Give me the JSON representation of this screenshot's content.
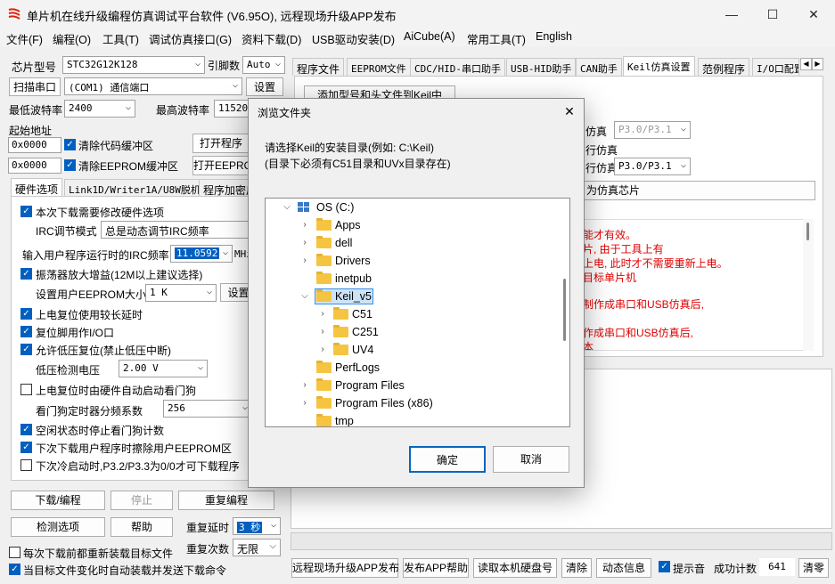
{
  "window": {
    "title": "单片机在线升级编程仿真调试平台软件 (V6.95O), 远程现场升级APP发布",
    "minimize": "—",
    "maximize": "☐",
    "close": "✕"
  },
  "menu": [
    "文件(F)",
    "编程(O)",
    "工具(T)",
    "调试仿真接口(G)",
    "资料下载(D)",
    "USB驱动安装(D)",
    "AiCube(A)",
    "常用工具(T)",
    "English"
  ],
  "left": {
    "chip_label": "芯片型号",
    "chip_value": "STC32G12K128",
    "pin_label": "引脚数",
    "pin_value": "Auto",
    "scan_button": "扫描串口",
    "port_value": "(COM1) 通信端口",
    "settings_button": "设置",
    "min_baud_label": "最低波特率",
    "min_baud_value": "2400",
    "max_baud_label": "最高波特率",
    "max_baud_value": "11520",
    "start_addr_label": "起始地址",
    "addr1": "0x0000",
    "clear_code_label": "清除代码缓冲区",
    "open_prog_button": "打开程序",
    "addr2": "0x0000",
    "clear_eeprom_label": "清除EEPROM缓冲区",
    "open_eeprom_button": "打开EEPRO",
    "tabs": [
      "硬件选项",
      "Link1D/Writer1A/U8W脱机",
      "程序加密后"
    ],
    "opt_modify_hw": "本次下载需要修改硬件选项",
    "irc_adjust_label": "IRC调节模式",
    "irc_adjust_value": "总是动态调节IRC频率",
    "irc_freq_label": "输入用户程序运行时的IRC频率",
    "irc_freq_value": "11.0592",
    "irc_unit": "MHz",
    "osc_gain": "振荡器放大增益(12M以上建议选择)",
    "eeprom_size_label": "设置用户EEPROM大小",
    "eeprom_size_value": "1   K",
    "eeprom_set_button": "设置",
    "long_reset_delay": "上电复位使用较长延时",
    "reset_pin_io": "复位脚用作I/O口",
    "lvd_reset": "允许低压复位(禁止低压中断)",
    "lvd_voltage_label": "低压检测电压",
    "lvd_voltage_value": "2.00 V",
    "wdt_auto": "上电复位时由硬件自动启动看门狗",
    "wdt_div_label": "看门狗定时器分频系数",
    "wdt_div_value": "256",
    "idle_stop_wdt": "空闲状态时停止看门狗计数",
    "erase_eeprom": "下次下载用户程序时擦除用户EEPROM区",
    "p32_p33": "下次冷启动时,P3.2/P3.3为0/0才可下载程序",
    "download_button": "下载/编程",
    "stop_button": "停止",
    "reprogram_button": "重复编程",
    "detect_button": "检测选项",
    "help_button": "帮助",
    "repeat_delay_label": "重复延时",
    "repeat_delay_value": "3 秒",
    "repeat_count_label": "重复次数",
    "repeat_count_value": "无限",
    "reload_each": "每次下载前都重新装载目标文件",
    "auto_reload": "当目标文件变化时自动装载并发送下载命令"
  },
  "right": {
    "tabs": [
      "程序文件",
      "EEPROM文件",
      "CDC/HID-串口助手",
      "USB-HID助手",
      "CAN助手",
      "Keil仿真设置",
      "范例程序",
      "I/O口配置"
    ],
    "add_to_keil": "添加型号和头文件到Keil中",
    "sim_label1": "仿真",
    "sim_value1": "P3.0/P3.1",
    "sim_label2": "行仿真",
    "sim_label3": "行仿真",
    "sim_value3": "P3.0/P3.1",
    "set_sim_chip": "为仿真芯片",
    "red_lines": [
      "能才有效。",
      "片, 由于工具上有",
      "上电, 此时才不需要重新上电。",
      "目标单片机",
      "制作成串口和USB仿真后,",
      "作成串口和USB仿真后,",
      "本"
    ]
  },
  "bottom": {
    "remote_publish": "远程现场升级APP发布",
    "publish_help": "发布APP帮助",
    "read_disk": "读取本机硬盘号",
    "clear": "清除",
    "dynamic_info": "动态信息",
    "beep_label": "提示音",
    "success_count_label": "成功计数",
    "success_count": "641",
    "reset_count": "清零"
  },
  "dialog": {
    "title": "浏览文件夹",
    "close": "✕",
    "instr1": "请选择Keil的安装目录(例如: C:\\Keil)",
    "instr2": "(目录下必须有C51目录和UVx目录存在)",
    "drive": "OS (C:)",
    "folders": [
      "Apps",
      "dell",
      "Drivers",
      "inetpub",
      "Keil_v5",
      "C51",
      "C251",
      "UV4",
      "PerfLogs",
      "Program Files",
      "Program Files (x86)",
      "tmp"
    ],
    "ok": "确定",
    "cancel": "取消"
  }
}
